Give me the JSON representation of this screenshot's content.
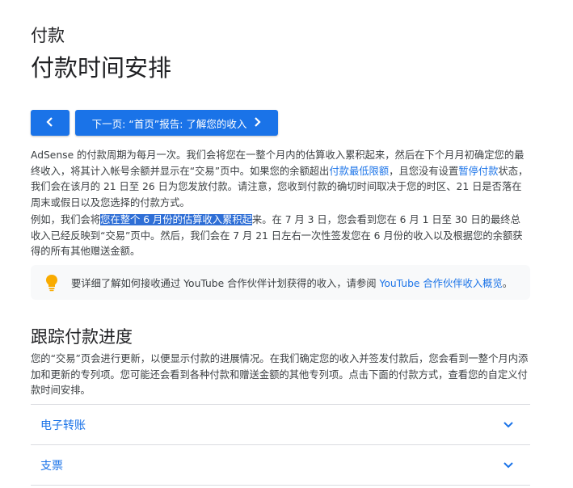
{
  "header": {
    "breadcrumb": "付款",
    "title": "付款时间安排"
  },
  "nav": {
    "back_icon": "chevron-left-icon",
    "next_label": "下一页: “首页”报告: 了解您的收入",
    "next_icon": "chevron-right-icon"
  },
  "para1": {
    "t1": "AdSense 的付款周期为每月一次。我们会将您在一整个月内的估算收入累积起来，然后在下个月月初确定您的最终收入，将其计入帐号余额并显示在“交易”页中。如果您的余额超出",
    "link1": "付款最低限额",
    "t2": "，且您没有设置",
    "link2": "暂停付款",
    "t3": "状态，我们会在该月的 21 日至 26 日为您发放付款。请注意，您收到付款的确切时间取决于您的时区、21 日是否落在周末或假日以及您选择的付款方式。"
  },
  "para2": {
    "t1": "例如，我们会将",
    "highlight": "您在整个 6 月份的估算收入累积起",
    "t2": "来。在 7 月 3 日，您会看到您在 6 月 1 日至 30 日的最终总收入已经反映到“交易”页中。然后，我们会在 7 月 21 日左右一次性签发您在 6 月份的收入以及根据您的余额获得的所有其他赠送金额。"
  },
  "tip": {
    "icon": "lightbulb-icon",
    "text": "要详细了解如何接收通过 YouTube 合作伙伴计划获得的收入，请参阅 ",
    "link": "YouTube 合作伙伴收入概览",
    "end": "。"
  },
  "section": {
    "title": "跟踪付款进度",
    "body": "您的“交易”页会进行更新，以便显示付款的进展情况。在我们确定您的收入并签发付款后，您会看到一整个月内添加和更新的专列项。您可能还会看到各种付款和赠送金额的其他专列项。点击下面的付款方式，查看您的自定义付款时间安排。"
  },
  "accordion": [
    {
      "label": "电子转账"
    },
    {
      "label": "支票"
    }
  ],
  "colors": {
    "accent": "#1a73e8",
    "highlight": "#2f6fd6",
    "tip_bg": "#f8f9fa",
    "bulb": "#f9ab00"
  }
}
